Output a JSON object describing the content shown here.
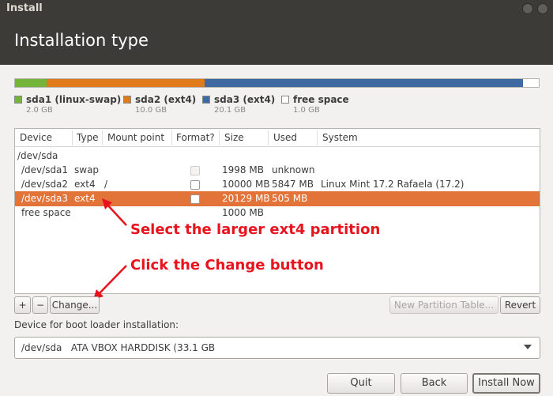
{
  "window": {
    "title": "Install"
  },
  "header": {
    "title": "Installation type"
  },
  "colors": {
    "swap": "#74b43b",
    "ext4_sda2": "#e07b1c",
    "ext4_sda3": "#3f6aa1",
    "free": "#ffffff",
    "selected_row": "#e2743a",
    "annotation": "#e8131d"
  },
  "disk_usage": [
    {
      "name": "sda1 (linux-swap)",
      "size": "2.0 GB",
      "fraction": 0.061
    },
    {
      "name": "sda2 (ext4)",
      "size": "10.0 GB",
      "fraction": 0.302
    },
    {
      "name": "sda3 (ext4)",
      "size": "20.1 GB",
      "fraction": 0.608
    },
    {
      "name": "free space",
      "size": "1.0 GB",
      "fraction": 0.029
    }
  ],
  "table": {
    "columns": [
      "Device",
      "Type",
      "Mount point",
      "Format?",
      "Size",
      "Used",
      "System"
    ],
    "rows": [
      {
        "device": "/dev/sda",
        "type": "",
        "mount": "",
        "format": null,
        "size": "",
        "used": "",
        "system": ""
      },
      {
        "device": "/dev/sda1",
        "type": "swap",
        "mount": "",
        "format": "disabled",
        "size": "1998 MB",
        "used": "unknown",
        "system": ""
      },
      {
        "device": "/dev/sda2",
        "type": "ext4",
        "mount": "/",
        "format": "unchecked",
        "size": "10000 MB",
        "used": "5847 MB",
        "system": "Linux Mint 17.2 Rafaela (17.2)"
      },
      {
        "device": "/dev/sda3",
        "type": "ext4",
        "mount": "",
        "format": "unchecked",
        "size": "20129 MB",
        "used": "505 MB",
        "system": "",
        "selected": true
      },
      {
        "device": "free space",
        "type": "",
        "mount": "",
        "format": null,
        "size": "1000 MB",
        "used": "",
        "system": ""
      }
    ]
  },
  "annotations": {
    "select_partition": "Select the larger ext4 partition",
    "click_change": "Click the Change button"
  },
  "partition_toolbar": {
    "add_label": "+",
    "remove_label": "−",
    "change_label": "Change...",
    "new_table_label": "New Partition Table...",
    "revert_label": "Revert"
  },
  "boot_loader": {
    "label": "Device for boot loader installation:",
    "selected_value": "/dev/sda   ATA VBOX HARDDISK (33.1 GB"
  },
  "buttons": {
    "quit": "Quit",
    "back": "Back",
    "install_now": "Install Now"
  }
}
